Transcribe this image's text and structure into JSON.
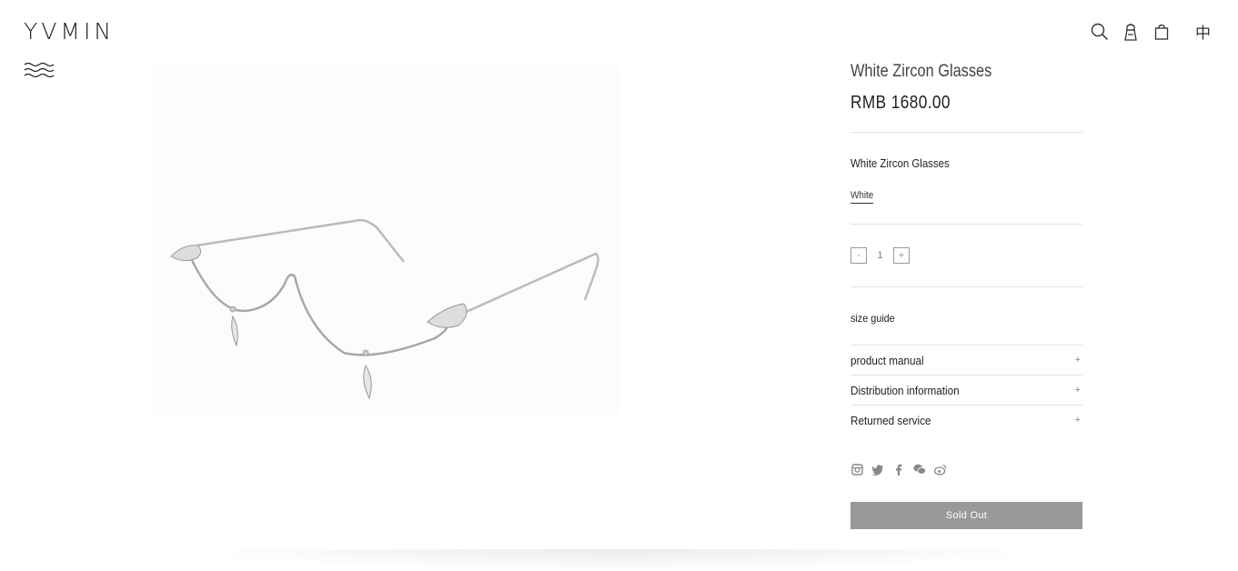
{
  "header": {
    "logo": "YVMIN",
    "language": "中"
  },
  "product": {
    "title": "White Zircon Glasses",
    "price": "RMB 1680.00",
    "variant_title": "White Zircon Glasses",
    "selected_color": "White",
    "quantity": "1",
    "qty_minus": "-",
    "qty_plus": "+"
  },
  "links": {
    "size_guide": "size guide"
  },
  "accordions": [
    {
      "label": "product manual",
      "icon": "+"
    },
    {
      "label": "Distribution information",
      "icon": "+"
    },
    {
      "label": "Returned service",
      "icon": "+"
    }
  ],
  "social": [
    "instagram-icon",
    "twitter-icon",
    "facebook-icon",
    "wechat-icon",
    "weibo-icon"
  ],
  "actions": {
    "sold_out": "Sold Out"
  },
  "colors": {
    "button": "#999999",
    "text": "#222222",
    "divider": "#e3e3e3"
  }
}
